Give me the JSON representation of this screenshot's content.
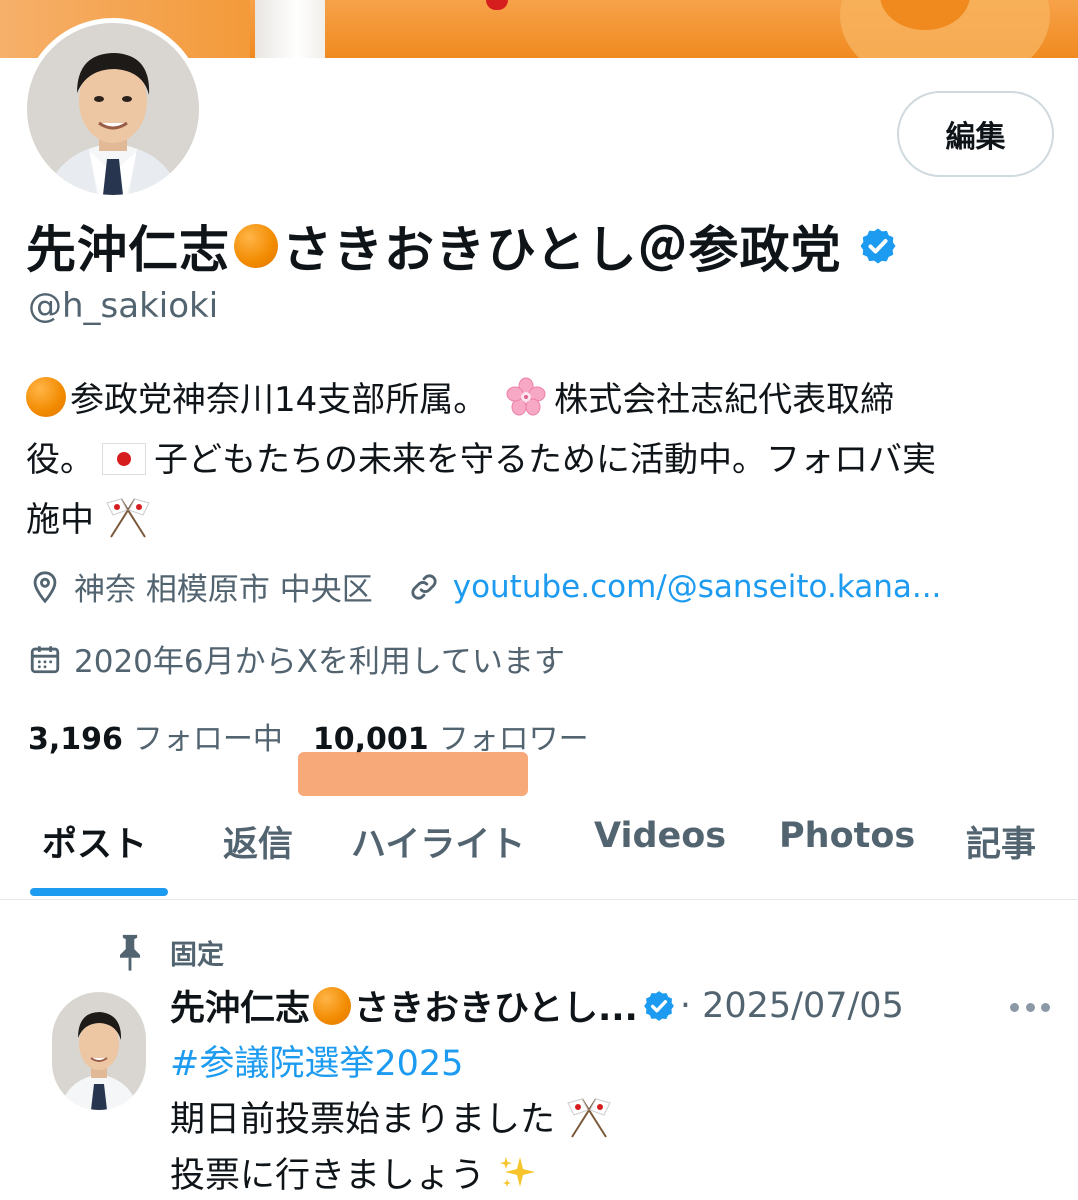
{
  "profile": {
    "edit_label": "編集",
    "name_part1": "先沖仁志",
    "name_part2": "さきおきひとし＠参政党",
    "handle": "@h_sakioki",
    "bio": {
      "line1_a": "参政党神奈川14支部所属。",
      "line1_b": "株式会社志紀代表取締",
      "line2_a": "役。",
      "line2_b": "子どもたちの未来を守るために活動中。フォロバ実",
      "line3": "施中"
    },
    "location": "神奈 相模原市 中央区",
    "website": "youtube.com/@sanseito.kana...",
    "joined": "2020年6月からXを利用しています",
    "following_count": "3,196",
    "following_label": "フォロー中",
    "followers_count": "10,001",
    "followers_label": "フォロワー"
  },
  "tabs": [
    "ポスト",
    "返信",
    "ハイライト",
    "Videos",
    "Photos",
    "記事"
  ],
  "active_tab": "ポスト",
  "pinned_post": {
    "pinned_label": "固定",
    "author_part1": "先沖仁志",
    "author_part2": "さきおきひとし...",
    "date": "· 2025/07/05",
    "hashtag": "#参議院選挙2025",
    "line1": "期日前投票始まりました",
    "line2": "投票に行きましょう"
  },
  "colors": {
    "accent": "#1d9bf0",
    "banner_orange": "#f08a1f",
    "highlight_marker": "#f6a06c",
    "text_primary": "#0f1419",
    "text_secondary": "#536471"
  },
  "icons": [
    "location-pin-icon",
    "link-icon",
    "calendar-icon",
    "verified-badge-icon",
    "pin-icon",
    "more-options-icon"
  ]
}
